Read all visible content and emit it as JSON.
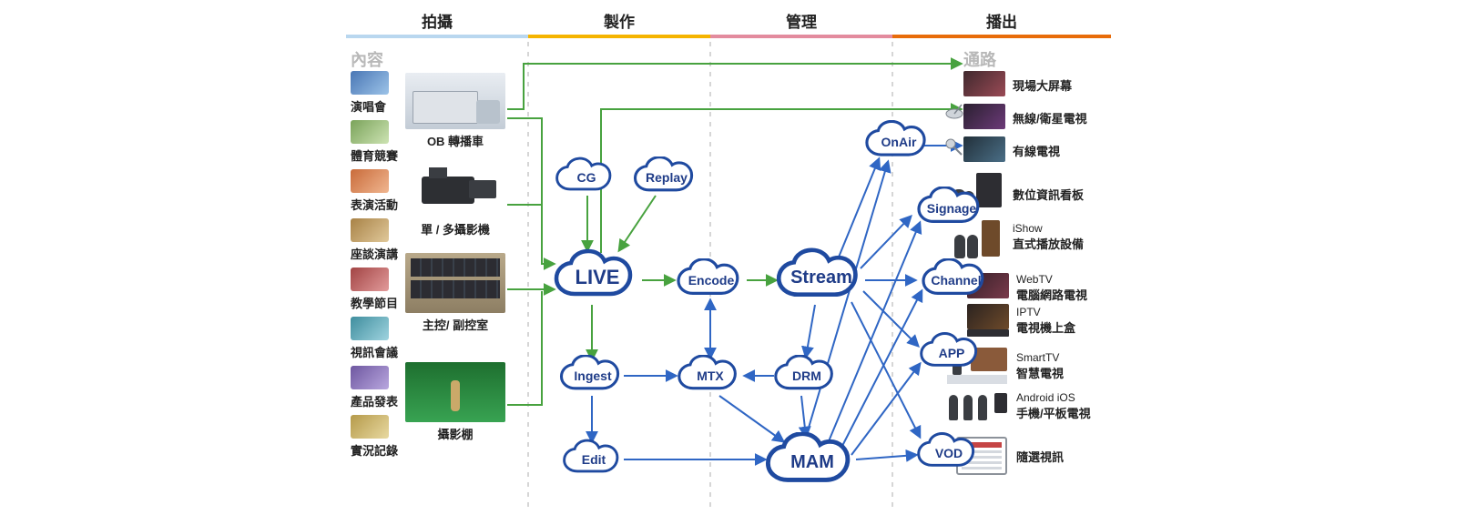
{
  "tabs": [
    {
      "label": "拍攝",
      "color": "#b9d7ef"
    },
    {
      "label": "製作",
      "color": "#f5b400"
    },
    {
      "label": "管理",
      "color": "#e38b9e"
    },
    {
      "label": "播出",
      "color": "#e86c0a"
    }
  ],
  "sections": {
    "left": "內容",
    "right": "通路"
  },
  "content_items": [
    {
      "label": "演唱會",
      "hue": 210
    },
    {
      "label": "體育競賽",
      "hue": 95
    },
    {
      "label": "表演活動",
      "hue": 15
    },
    {
      "label": "座談演講",
      "hue": 35
    },
    {
      "label": "教學節目",
      "hue": 0
    },
    {
      "label": "視訊會議",
      "hue": 190
    },
    {
      "label": "產品發表",
      "hue": 260
    },
    {
      "label": "實況記錄",
      "hue": 45
    }
  ],
  "capture_items": [
    {
      "label": "OB 轉播車"
    },
    {
      "label": "單 / 多攝影機"
    },
    {
      "label": "主控/ 副控室"
    },
    {
      "label": "攝影棚"
    }
  ],
  "clouds": {
    "cg": "CG",
    "replay": "Replay",
    "live": "LIVE",
    "ingest": "Ingest",
    "edit": "Edit",
    "encode": "Encode",
    "mtx": "MTX",
    "drm": "DRM",
    "stream": "Stream",
    "mam": "MAM",
    "onair": "OnAir",
    "signage": "Signage",
    "channel": "Channel",
    "app": "APP",
    "vod": "VOD"
  },
  "channels": [
    {
      "label": "現場大屏幕"
    },
    {
      "label": "無線/衛星電視"
    },
    {
      "label": "有線電視"
    },
    {
      "label": "數位資訊看板"
    },
    {
      "label": "iShow",
      "sub": "直式播放設備"
    },
    {
      "label": "WebTV",
      "sub": "電腦網路電視"
    },
    {
      "label": "IPTV",
      "sub": "電視機上盒"
    },
    {
      "label": "SmartTV",
      "sub": "智慧電視"
    },
    {
      "label": "Android  iOS",
      "sub": "手機/平板電視"
    },
    {
      "label": "隨選視訊"
    }
  ]
}
